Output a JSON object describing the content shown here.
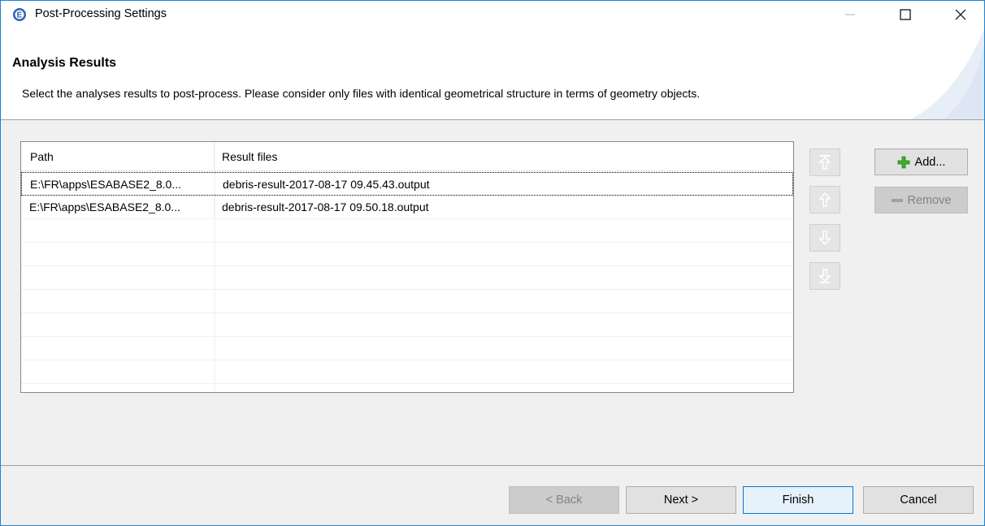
{
  "window": {
    "title": "Post-Processing Settings"
  },
  "header": {
    "title": "Analysis Results",
    "description": "Select the analyses results to post-process. Please consider only files with identical geometrical structure in terms of geometry objects."
  },
  "table": {
    "columns": [
      "Path",
      "Result files"
    ],
    "rows": [
      {
        "path": "E:\\FR\\apps\\ESABASE2_8.0...",
        "result": "debris-result-2017-08-17 09.45.43.output",
        "selected": true
      },
      {
        "path": "E:\\FR\\apps\\ESABASE2_8.0...",
        "result": "debris-result-2017-08-17 09.50.18.output",
        "selected": false
      }
    ]
  },
  "side_buttons": {
    "add_label": "Add...",
    "remove_label": "Remove"
  },
  "arrow_buttons": [
    "move-to-top-icon",
    "move-up-icon",
    "move-down-icon",
    "move-to-bottom-icon"
  ],
  "footer": {
    "back_label": "< Back",
    "next_label": "Next >",
    "finish_label": "Finish",
    "cancel_label": "Cancel"
  },
  "colors": {
    "accent": "#0078d7",
    "add_icon_green": "#3fae2a"
  }
}
